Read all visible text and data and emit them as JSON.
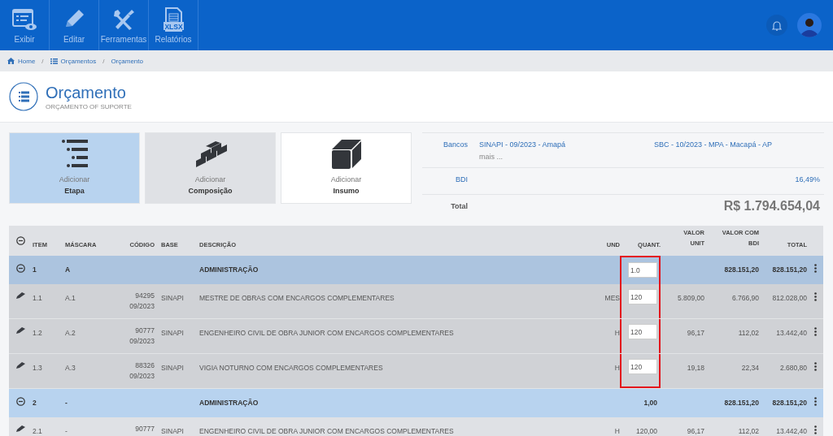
{
  "toolbar": [
    {
      "label": "Exibir",
      "kind": "view"
    },
    {
      "label": "Editar",
      "kind": "edit"
    },
    {
      "label": "Ferramentas",
      "kind": "tools"
    },
    {
      "label": "Relatórios",
      "kind": "xlsx",
      "badge": "XLSX"
    }
  ],
  "breadcrumb": [
    {
      "label": "Home"
    },
    {
      "separator": "/",
      "label": "Orçamentos"
    },
    {
      "separator": "/",
      "label": "Orçamento"
    }
  ],
  "header": {
    "title": "Orçamento",
    "subtitle": "ORÇAMENTO OF SUPORTE"
  },
  "add_cards": [
    {
      "kind": "etapa",
      "action": "Adicionar",
      "label": "Etapa",
      "selected": true,
      "hovered": false
    },
    {
      "kind": "composicao",
      "action": "Adicionar",
      "label": "Composição",
      "selected": false,
      "hovered": true
    },
    {
      "kind": "insumo",
      "action": "Adicionar",
      "label": "Insumo",
      "selected": false,
      "hovered": false
    }
  ],
  "summary": {
    "bancos_label": "Bancos",
    "bancos": [
      "SINAPI - 09/2023 - Amapá",
      "SBC - 10/2023 - MPA - Macapá - AP"
    ],
    "more": "mais ...",
    "bdi_label": "BDI",
    "bdi": "16,49%",
    "total_label": "Total",
    "total": "R$ 1.794.654,04"
  },
  "table": {
    "columns": [
      "ITEM",
      "MÁSCARA",
      "CÓDIGO",
      "BASE",
      "DESCRIÇÃO",
      "UND",
      "QUANT.",
      "VALOR UNIT",
      "VALOR COM BDI",
      "TOTAL"
    ],
    "rows": [
      {
        "kind": "group",
        "item": "1",
        "mask": "A",
        "description": "ADMINISTRAÇÃO",
        "quant": {
          "kind": "input",
          "value": "1.0"
        },
        "highlighted": true,
        "value_bdi": "828.151,20",
        "total": "828.151,20",
        "selected": true
      },
      {
        "kind": "item",
        "item": "1.1",
        "mask": "A.1",
        "code": "94295",
        "code_date": "09/2023",
        "base": "SINAPI",
        "description": "MESTRE DE OBRAS COM ENCARGOS COMPLEMENTARES",
        "unit": "MES",
        "quant": {
          "kind": "input",
          "value": "120"
        },
        "highlighted": true,
        "value_unit": "5.809,00",
        "value_bdi": "6.766,90",
        "total": "812.028,00",
        "selected": true
      },
      {
        "kind": "item",
        "item": "1.2",
        "mask": "A.2",
        "code": "90777",
        "code_date": "09/2023",
        "base": "SINAPI",
        "description": "ENGENHEIRO CIVIL DE OBRA JUNIOR COM ENCARGOS COMPLEMENTARES",
        "unit": "H",
        "quant": {
          "kind": "input",
          "value": "120"
        },
        "highlighted": true,
        "value_unit": "96,17",
        "value_bdi": "112,02",
        "total": "13.442,40",
        "selected": true
      },
      {
        "kind": "item",
        "item": "1.3",
        "mask": "A.3",
        "code": "88326",
        "code_date": "09/2023",
        "base": "SINAPI",
        "description": "VIGIA NOTURNO COM ENCARGOS COMPLEMENTARES",
        "unit": "H",
        "quant": {
          "kind": "input",
          "value": "120"
        },
        "highlighted": true,
        "value_unit": "19,18",
        "value_bdi": "22,34",
        "total": "2.680,80",
        "selected": true
      },
      {
        "kind": "group",
        "item": "2",
        "mask": "-",
        "description": "ADMINISTRAÇÃO",
        "quant": {
          "kind": "text",
          "value": "1,00"
        },
        "highlighted": false,
        "value_bdi": "828.151,20",
        "total": "828.151,20",
        "selected": false
      },
      {
        "kind": "item",
        "item": "2.1",
        "mask": "-",
        "code": "90777",
        "base": "SINAPI",
        "description": "ENGENHEIRO CIVIL DE OBRA JUNIOR COM ENCARGOS COMPLEMENTARES",
        "unit": "H",
        "quant": {
          "kind": "text",
          "value": "120,00"
        },
        "highlighted": false,
        "value_unit": "96,17",
        "value_bdi": "112,02",
        "total": "13.442,40",
        "selected": false
      }
    ]
  }
}
